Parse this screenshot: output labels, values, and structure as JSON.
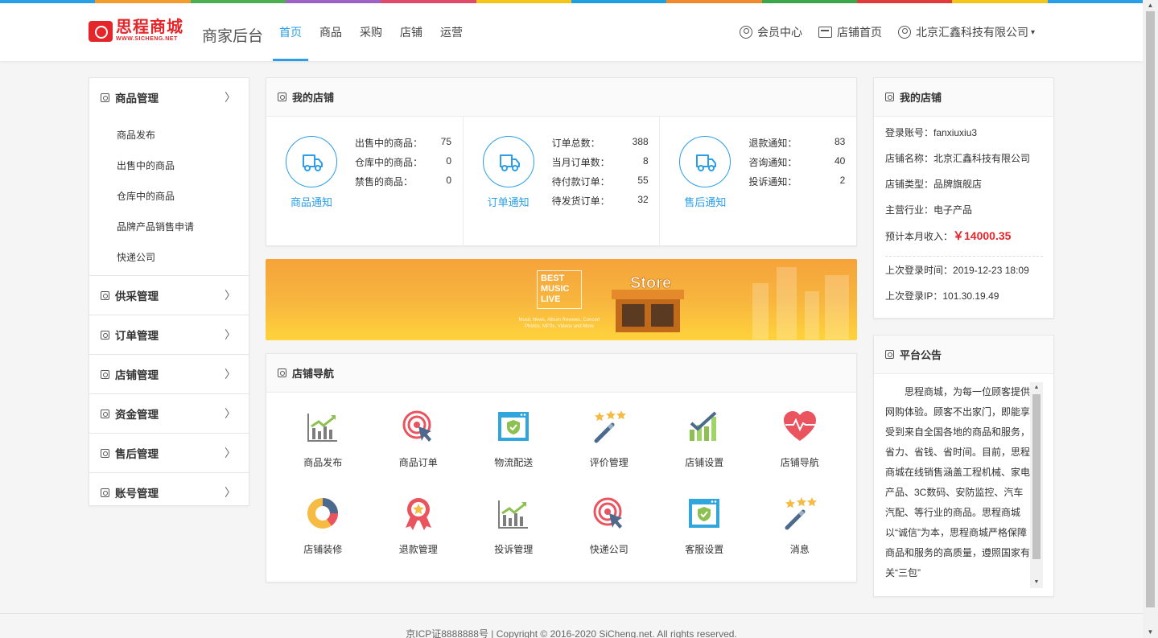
{
  "colors": {
    "accent": "#2a9ee6",
    "brand_red": "#e4262b",
    "stripe": [
      "#2a9ee6",
      "#f39c2c",
      "#4caf50",
      "#9c62c6",
      "#e24a6b",
      "#f5c518",
      "#1fa1e0",
      "#f08a2c",
      "#3aa74b",
      "#e23b3b",
      "#f5c518",
      "#2a9ee6"
    ]
  },
  "header": {
    "logo_cn": "思程商城",
    "logo_en": "WWW.SICHENG.NET",
    "site_name": "商家后台",
    "nav": [
      "首页",
      "商品",
      "采购",
      "店铺",
      "运营"
    ],
    "member_center": "会员中心",
    "shop_home": "店铺首页",
    "company": "北京汇鑫科技有限公司"
  },
  "sidebar": {
    "groups": [
      {
        "label": "商品管理",
        "items": [
          "商品发布",
          "出售中的商品",
          "仓库中的商品",
          "品牌产品销售申请",
          "快递公司"
        ]
      },
      {
        "label": "供采管理"
      },
      {
        "label": "订单管理"
      },
      {
        "label": "店铺管理"
      },
      {
        "label": "资金管理"
      },
      {
        "label": "售后管理"
      },
      {
        "label": "账号管理"
      }
    ]
  },
  "my_store": {
    "title": "我的店铺",
    "stats": [
      {
        "name": "商品通知",
        "icon": "truck-icon",
        "rows": [
          {
            "k": "出售中的商品：",
            "v": "75"
          },
          {
            "k": "仓库中的商品：",
            "v": "0"
          },
          {
            "k": "禁售的商品：",
            "v": "0"
          }
        ]
      },
      {
        "name": "订单通知",
        "icon": "truck-icon",
        "rows": [
          {
            "k": "订单总数：",
            "v": "388"
          },
          {
            "k": "当月订单数：",
            "v": "8"
          },
          {
            "k": "待付款订单：",
            "v": "55"
          },
          {
            "k": "待发货订单：",
            "v": "32"
          }
        ]
      },
      {
        "name": "售后通知",
        "icon": "truck-icon",
        "rows": [
          {
            "k": "退款通知：",
            "v": "83"
          },
          {
            "k": "咨询通知：",
            "v": "40"
          },
          {
            "k": "投诉通知：",
            "v": "2"
          }
        ]
      }
    ]
  },
  "banner": {
    "best": "BEST",
    "music": "MUSIC",
    "live": "LIVE",
    "store": "Store",
    "small": "Music News, Album Reviews, Concert Photos, MP3s, Videos and More"
  },
  "shop_nav": {
    "title": "店铺导航",
    "items": [
      {
        "label": "商品发布",
        "icon": "bar-chart-icon"
      },
      {
        "label": "商品订单",
        "icon": "target-cursor-icon"
      },
      {
        "label": "物流配送",
        "icon": "shield-window-icon"
      },
      {
        "label": "评价管理",
        "icon": "magic-wand-icon"
      },
      {
        "label": "店铺设置",
        "icon": "check-chart-icon"
      },
      {
        "label": "店铺导航",
        "icon": "heart-pulse-icon"
      },
      {
        "label": "店铺装修",
        "icon": "donut-chart-icon"
      },
      {
        "label": "退款管理",
        "icon": "award-ribbon-icon"
      },
      {
        "label": "投诉管理",
        "icon": "bar-chart-icon"
      },
      {
        "label": "快递公司",
        "icon": "target-cursor-icon"
      },
      {
        "label": "客服设置",
        "icon": "shield-window-icon"
      },
      {
        "label": "消息",
        "icon": "magic-wand-icon"
      }
    ]
  },
  "store_info": {
    "title": "我的店铺",
    "login_label": "登录账号：",
    "login": "fanxiuxiu3",
    "name_label": "店铺名称：",
    "name": "北京汇鑫科技有限公司",
    "type_label": "店铺类型：",
    "type": "品牌旗舰店",
    "industry_label": "主营行业：",
    "industry": "电子产品",
    "income_label": "预计本月收入：",
    "income": "￥14000.35",
    "last_time_label": "上次登录时间：",
    "last_time": "2019-12-23 18:09",
    "last_ip_label": "上次登录IP：",
    "last_ip": "101.30.19.49"
  },
  "notice": {
    "title": "平台公告",
    "text": "思程商城，为每一位顾客提供网购体验。顾客不出家门，即能享受到来自全国各地的商品和服务，省力、省钱、省时间。目前，思程商城在线销售涵盖工程机械、家电产品、3C数码、安防监控、汽车汽配、等行业的商品。思程商城以“诚信”为本，思程商城严格保障商品和服务的高质量，遵照国家有关“三包”"
  },
  "footer": "京ICP证8888888号 | Copyright © 2016-2020 SiCheng.net. All rights reserved."
}
